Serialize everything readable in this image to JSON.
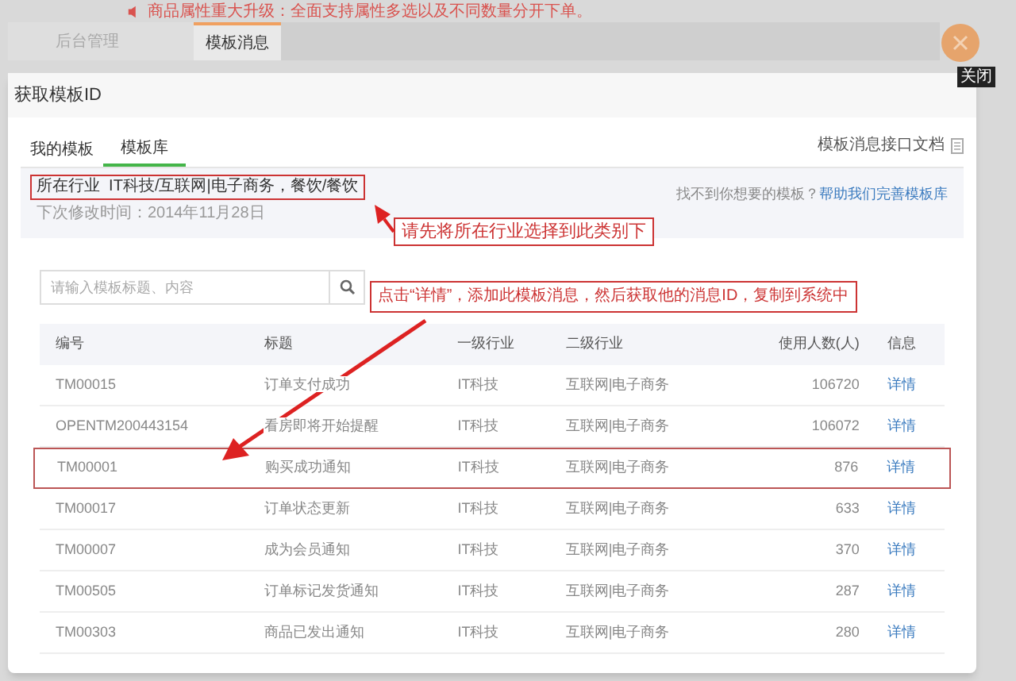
{
  "notice": "商品属性重大升级：全面支持属性多选以及不同数量分开下单。",
  "top_tabs": [
    {
      "label": "后台管理",
      "selected": false
    },
    {
      "label": "模板消息",
      "selected": true
    }
  ],
  "close_tooltip": "关闭",
  "dialog": {
    "title": "获取模板ID",
    "tabs": [
      {
        "label": "我的模板",
        "selected": false
      },
      {
        "label": "模板库",
        "selected": true
      }
    ],
    "doc_link": "模板消息接口文档",
    "industry": "所在行业  IT科技/互联网|电子商务，餐饮/餐饮",
    "next_change": "下次修改时间：2014年11月28日",
    "help_text": "找不到你想要的模板？",
    "help_link": "帮助我们完善模板库",
    "search": {
      "placeholder": "请输入模板标题、内容"
    },
    "table": {
      "columns": [
        "编号",
        "标题",
        "一级行业",
        "二级行业",
        "使用人数(人)",
        "信息"
      ],
      "rows": [
        {
          "cells": [
            "TM00015",
            "订单支付成功",
            "IT科技",
            "互联网|电子商务",
            "106720",
            "详情"
          ],
          "highlighted": false
        },
        {
          "cells": [
            "OPENTM200443154",
            "看房即将开始提醒",
            "IT科技",
            "互联网|电子商务",
            "106072",
            "详情"
          ],
          "highlighted": false
        },
        {
          "cells": [
            "TM00001",
            "购买成功通知",
            "IT科技",
            "互联网|电子商务",
            "876",
            "详情"
          ],
          "highlighted": true
        },
        {
          "cells": [
            "TM00017",
            "订单状态更新",
            "IT科技",
            "互联网|电子商务",
            "633",
            "详情"
          ],
          "highlighted": false
        },
        {
          "cells": [
            "TM00007",
            "成为会员通知",
            "IT科技",
            "互联网|电子商务",
            "370",
            "详情"
          ],
          "highlighted": false
        },
        {
          "cells": [
            "TM00505",
            "订单标记发货通知",
            "IT科技",
            "互联网|电子商务",
            "287",
            "详情"
          ],
          "highlighted": false
        },
        {
          "cells": [
            "TM00303",
            "商品已发出通知",
            "IT科技",
            "互联网|电子商务",
            "280",
            "详情"
          ],
          "highlighted": false
        }
      ]
    }
  },
  "annotations": [
    "请先将所在行业选择到此类别下",
    "点击“详情”，添加此模板消息，然后获取他的消息ID，复制到系统中"
  ]
}
